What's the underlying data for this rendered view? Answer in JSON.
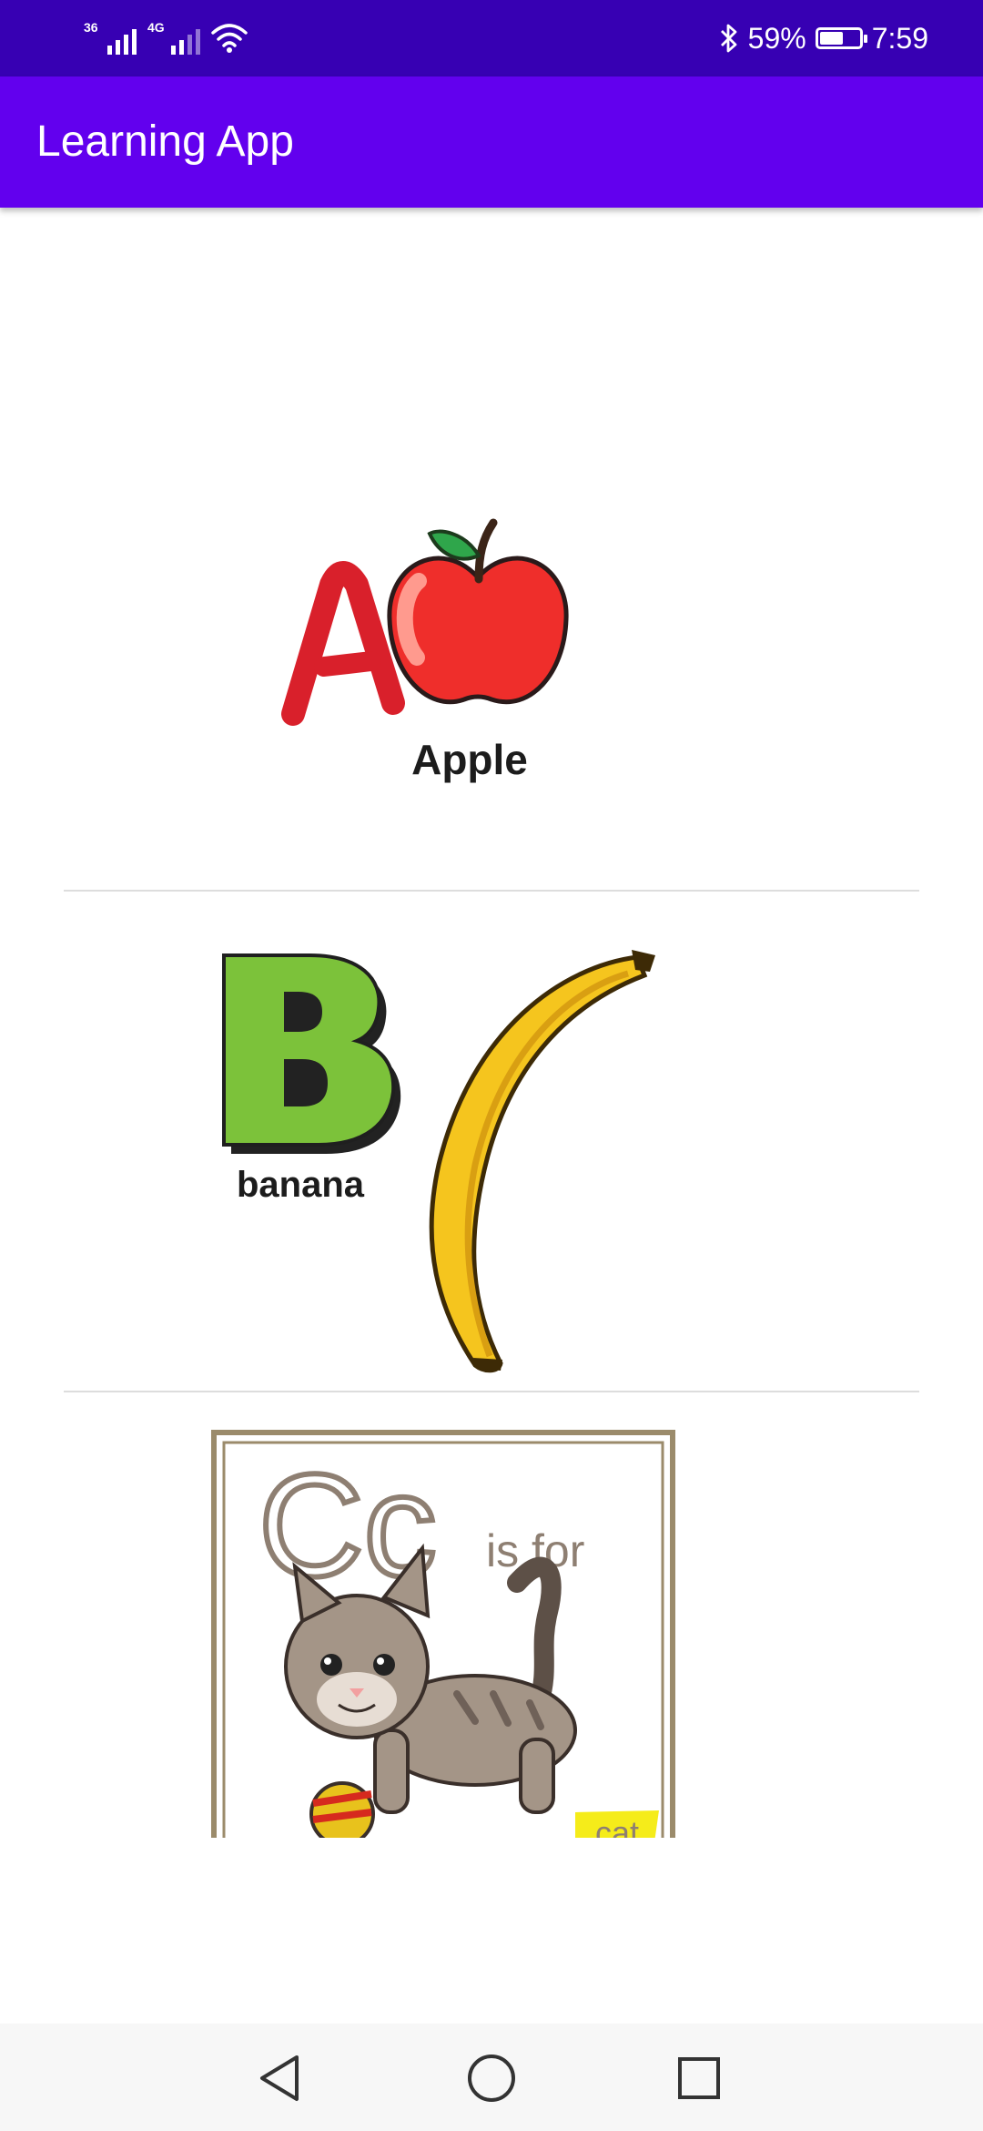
{
  "status_bar": {
    "network_1": "36",
    "network_2": "4G",
    "battery_percent": "59%",
    "battery_level": 0.59,
    "time": "7:59",
    "icons": [
      "signal-icon",
      "signal-icon",
      "wifi-icon",
      "bluetooth-icon",
      "battery-icon"
    ]
  },
  "app_bar": {
    "title": "Learning App",
    "color": "#6200ee"
  },
  "status_bar_color": "#3700b3",
  "list": {
    "items": [
      {
        "letter": "A",
        "word": "Apple",
        "image": "apple-card"
      },
      {
        "letter": "B",
        "word": "banana",
        "image": "banana-card"
      },
      {
        "letter": "Cc",
        "caption": "is for",
        "word": "cat",
        "image": "cat-card"
      }
    ]
  },
  "nav_bar": {
    "icons": [
      "back-icon",
      "home-icon",
      "recents-icon"
    ]
  }
}
